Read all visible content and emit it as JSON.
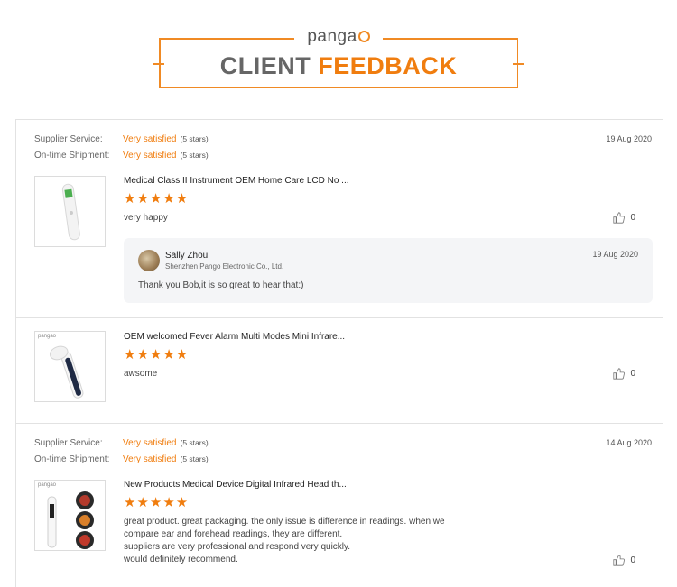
{
  "header": {
    "logo": "pangao",
    "logo_main": "panga",
    "title_gray": "CLIENT",
    "title_orange": "FEEDBACK"
  },
  "colors": {
    "accent": "#f07d0f",
    "frame": "#f08a24",
    "reply_bg": "#f4f5f7"
  },
  "labels": {
    "supplier_service": "Supplier Service:",
    "ontime_shipment": "On-time Shipment:"
  },
  "reviews": [
    {
      "supplier_value": "Very satisfied",
      "supplier_stars": "(5 stars)",
      "shipment_value": "Very satisfied",
      "shipment_stars": "(5 stars)",
      "date": "19 Aug 2020",
      "product_title": "Medical Class II Instrument OEM Home Care LCD No ...",
      "rating": "★★★★★",
      "comment": "very happy",
      "likes": "0",
      "thumbnail_icon": "thermometer-image",
      "reply": {
        "name": "Sally Zhou",
        "company": "Shenzhen Pango Electronic Co., Ltd.",
        "date": "19 Aug 2020",
        "text": "Thank you Bob,it is so great to hear that:)"
      }
    },
    {
      "product_title": "OEM welcomed Fever Alarm Multi Modes Mini Infrare...",
      "rating": "★★★★★",
      "comment": "awsome",
      "likes": "0",
      "thumbnail_label": "pangao",
      "thumbnail_icon": "thermometer-image"
    },
    {
      "supplier_value": "Very satisfied",
      "supplier_stars": "(5 stars)",
      "shipment_value": "Very satisfied",
      "shipment_stars": "(5 stars)",
      "date": "14 Aug 2020",
      "product_title": "New Products Medical Device Digital Infrared Head th...",
      "rating": "★★★★★",
      "comment_lines": [
        "great product. great packaging. the only issue is difference in readings. when we",
        "compare ear and forehead readings, they are different.",
        "suppliers are very professional and respond very quickly.",
        "would definitely recommend."
      ],
      "likes": "0",
      "thumbnail_label": "pangao",
      "thumbnail_icon": "thermometer-image"
    }
  ]
}
